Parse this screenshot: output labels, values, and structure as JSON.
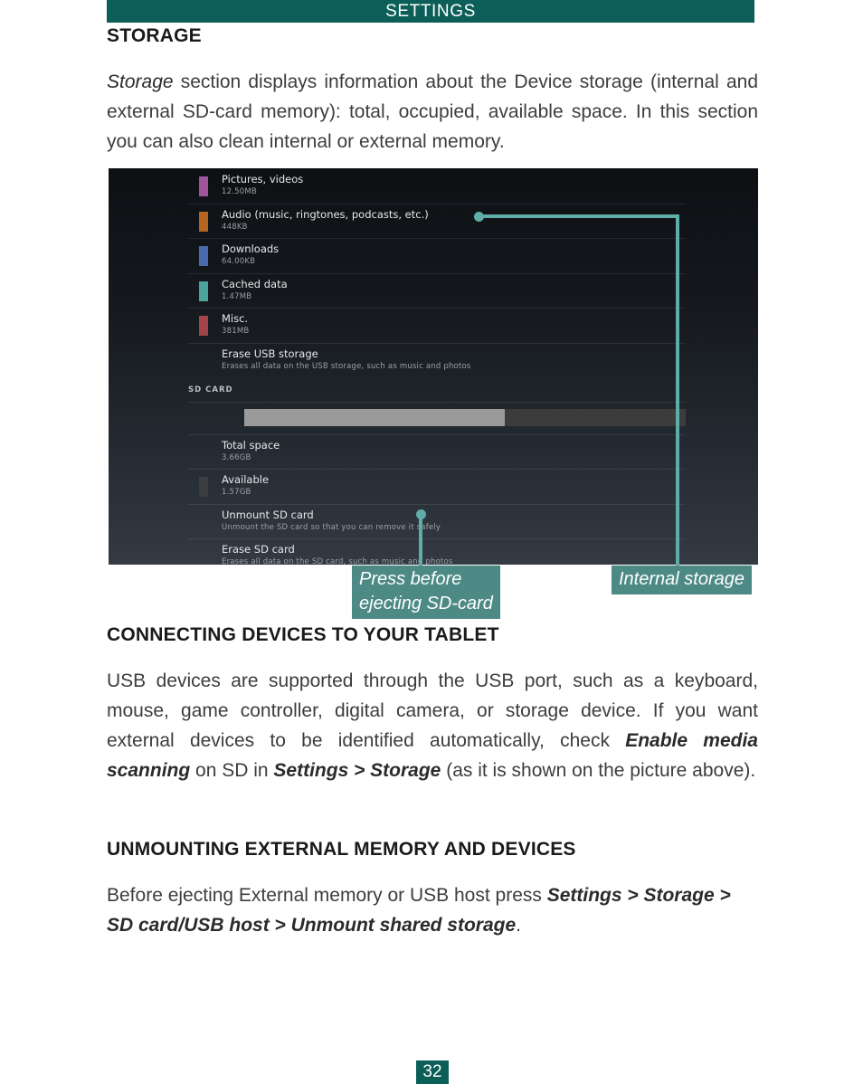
{
  "header": {
    "title": "SETTINGS"
  },
  "page": {
    "number": "32"
  },
  "colors": {
    "brand_teal": "#0c5f58",
    "callout_teal": "#4d8a86",
    "leader_teal": "#5fada8"
  },
  "sections": [
    {
      "heading": "STORAGE",
      "paragraph_html": "<i class=\"plain\">Storage</i> section displays information about the Device storage (internal and external SD-card memory): total, occupied, available space. In this section you can also clean internal or external memory."
    },
    {
      "heading": "CONNECTING DEVICES TO YOUR TABLET",
      "paragraph_html": "USB devices are supported through the USB port, such as a keyboard, mouse, game controller, digital camera, or storage device. If you want external devices to be identified automatically, check <i>Enable media scanning</i> on SD in <i>Settings &gt; Storage</i> (as it is shown on the picture above)."
    },
    {
      "heading": "UNMOUNTING EXTERNAL MEMORY AND DEVICES",
      "paragraph_html": "Before ejecting External memory or USB host press <i>Settings &gt; Storage &gt; SD card/USB host &gt; Unmount shared storage</i>."
    }
  ],
  "screenshot": {
    "rows": [
      {
        "title": "Pictures, videos",
        "sub": "12.50MB",
        "chip": "#a0549b",
        "type": "item",
        "divider": false
      },
      {
        "title": "Audio (music, ringtones, podcasts, etc.)",
        "sub": "448KB",
        "chip": "#b5651f",
        "type": "item",
        "divider": true
      },
      {
        "title": "Downloads",
        "sub": "64.00KB",
        "chip": "#4a6ab0",
        "type": "item",
        "divider": true
      },
      {
        "title": "Cached data",
        "sub": "1.47MB",
        "chip": "#49a59b",
        "type": "item",
        "divider": true
      },
      {
        "title": "Misc.",
        "sub": "381MB",
        "chip": "#a3434a",
        "type": "item",
        "divider": true
      },
      {
        "title": "Erase USB storage",
        "sub": "Erases all data on the USB storage, such as music and photos",
        "chip": "",
        "type": "action",
        "divider": true
      },
      {
        "title": "SD CARD",
        "sub": "",
        "chip": "",
        "type": "group",
        "divider": false
      },
      {
        "title": "",
        "sub": "",
        "chip": "",
        "type": "bar",
        "divider": true,
        "fill_percent": 59
      },
      {
        "title": "Total space",
        "sub": "3.66GB",
        "chip": "",
        "type": "item",
        "divider": true
      },
      {
        "title": "Available",
        "sub": "1.57GB",
        "chip": "#3b3f44",
        "type": "item",
        "divider": true
      },
      {
        "title": "Unmount SD card",
        "sub": "Unmount the SD card so that you can remove it safely",
        "chip": "",
        "type": "action",
        "divider": true
      },
      {
        "title": "Erase SD card",
        "sub": "Erases all data on the SD card, such as music and photos",
        "chip": "",
        "type": "action",
        "divider": true
      }
    ]
  },
  "callouts": [
    {
      "name": "internal-storage",
      "text": "Internal storage"
    },
    {
      "name": "press-before-ejecting",
      "text": "Press before\nejecting SD-card"
    }
  ]
}
